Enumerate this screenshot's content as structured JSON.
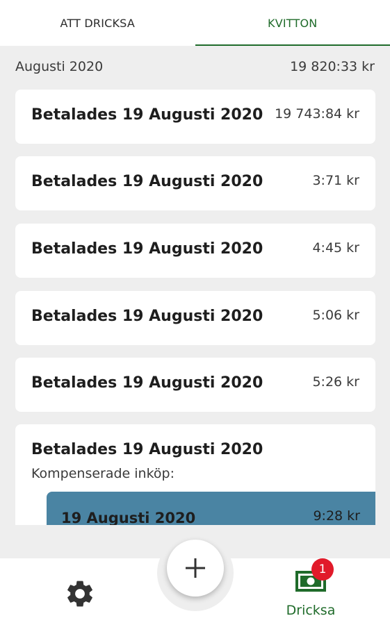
{
  "tabs": [
    {
      "label": "ATT DRICKSA",
      "active": false
    },
    {
      "label": "KVITTON",
      "active": true
    }
  ],
  "month": {
    "label": "Augusti 2020",
    "total": "19 820:33 kr"
  },
  "receipts": [
    {
      "title": "Betalades 19 Augusti 2020",
      "amount": "19 743:84 kr"
    },
    {
      "title": "Betalades 19 Augusti 2020",
      "amount": "3:71 kr"
    },
    {
      "title": "Betalades 19 Augusti 2020",
      "amount": "4:45 kr"
    },
    {
      "title": "Betalades 19 Augusti 2020",
      "amount": "5:06 kr"
    },
    {
      "title": "Betalades 19 Augusti 2020",
      "amount": "5:26 kr"
    }
  ],
  "expanded_receipt": {
    "title": "Betalades 19 Augusti 2020",
    "subtitle": "Kompenserade inköp:",
    "purchase": {
      "date": "19 Augusti 2020",
      "amount": "9:28 kr"
    }
  },
  "bottom_nav": {
    "settings_icon": "gear-icon",
    "add_icon": "plus-icon",
    "tip": {
      "label": "Dricksa",
      "icon": "cash-icon",
      "badge": "1"
    }
  },
  "colors": {
    "accent_green": "#1f6b2a",
    "purchase_blue": "#4a84a3",
    "badge_red": "#e11a2a",
    "background": "#eeeeee"
  }
}
